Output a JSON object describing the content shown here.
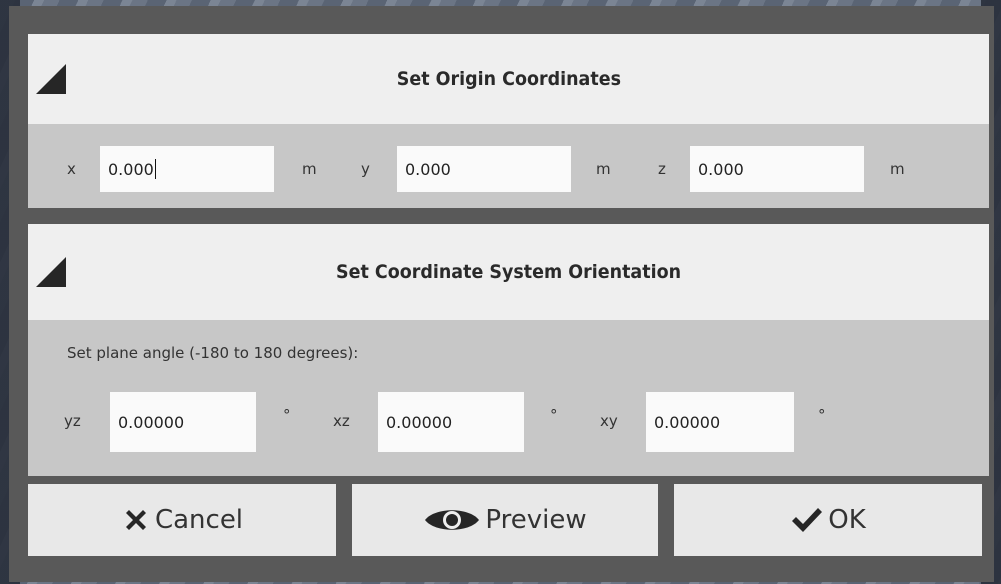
{
  "origin": {
    "title": "Set Origin Coordinates",
    "fields": [
      {
        "label": "x",
        "value": "0.000",
        "unit": "m"
      },
      {
        "label": "y",
        "value": "0.000",
        "unit": "m"
      },
      {
        "label": "z",
        "value": "0.000",
        "unit": "m"
      }
    ]
  },
  "orientation": {
    "title": "Set Coordinate System Orientation",
    "instruction": "Set plane angle (-180 to 180 degrees):",
    "fields": [
      {
        "label": "yz",
        "value": "0.00000",
        "unit": "°"
      },
      {
        "label": "xz",
        "value": "0.00000",
        "unit": "°"
      },
      {
        "label": "xy",
        "value": "0.00000",
        "unit": "°"
      }
    ]
  },
  "buttons": {
    "cancel": "Cancel",
    "preview": "Preview",
    "ok": "OK"
  },
  "icons": {
    "collapse": "triangle-collapse-icon",
    "cancel": "x-icon",
    "preview": "eye-icon",
    "ok": "checkmark-icon"
  }
}
